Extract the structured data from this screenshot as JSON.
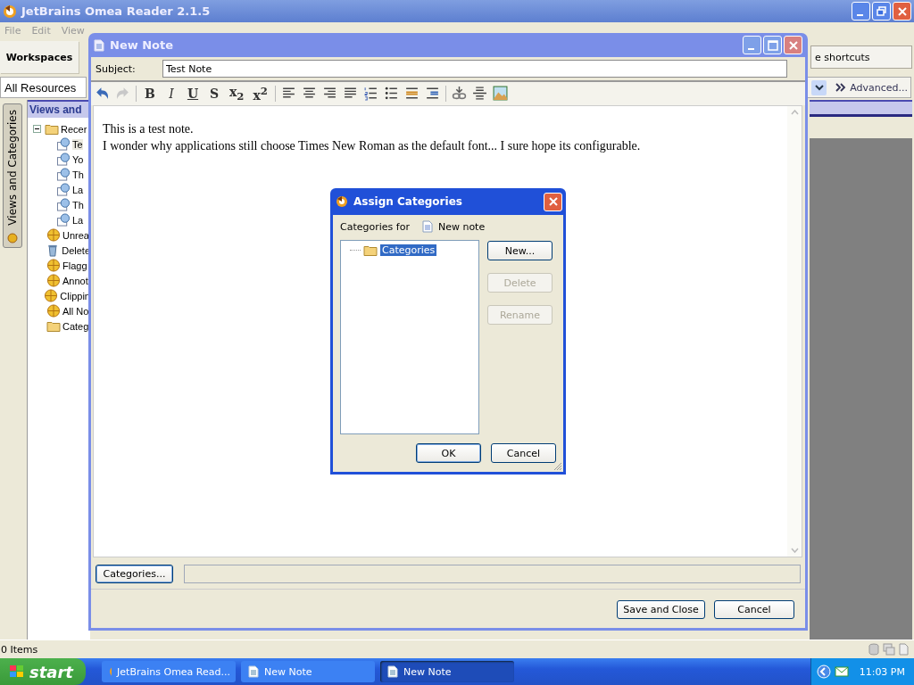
{
  "app": {
    "title": "JetBrains Omea Reader 2.1.5",
    "menu": [
      "File",
      "Edit",
      "View"
    ],
    "workspaces_tab": "Workspaces",
    "shortcuts_button": "e shortcuts",
    "resource_filter": "All Resources",
    "advanced_button": "Advanced...",
    "side_tab": "Views and Categories",
    "tree_header": "Views and",
    "tree": [
      {
        "label": "Recer",
        "kind": "folder",
        "expanded": true,
        "children": [
          {
            "label": "Te",
            "kind": "view",
            "selected": true
          },
          {
            "label": "Yo",
            "kind": "view",
            "selected": false
          },
          {
            "label": "Th",
            "kind": "view",
            "selected": false
          },
          {
            "label": "La",
            "kind": "view",
            "selected": false
          },
          {
            "label": "Th",
            "kind": "view",
            "selected": false
          },
          {
            "label": "La",
            "kind": "view",
            "selected": false
          }
        ]
      },
      {
        "label": "Unrea",
        "kind": "filter"
      },
      {
        "label": "Delete",
        "kind": "trash"
      },
      {
        "label": "Flagg",
        "kind": "filter"
      },
      {
        "label": "Annot",
        "kind": "filter"
      },
      {
        "label": "Clippin",
        "kind": "filter"
      },
      {
        "label": "All No",
        "kind": "filter"
      },
      {
        "label": "Categ",
        "kind": "folder"
      }
    ],
    "status": "0 Items"
  },
  "note_window": {
    "title": "New Note",
    "subject_label": "Subject:",
    "subject": "Test Note",
    "format_buttons": [
      {
        "label": "B"
      },
      {
        "label": "I"
      },
      {
        "label": "U"
      },
      {
        "label": "S"
      },
      {
        "label": "x$_{2}$"
      },
      {
        "label": "x$^{2}$"
      }
    ],
    "body": [
      "This is a test note.",
      "I wonder why applications still choose Times New Roman as the default font... I sure hope its configurable."
    ],
    "categories_button": "Categories...",
    "save_button": "Save and Close",
    "cancel_button": "Cancel"
  },
  "dialog": {
    "title": "Assign Categories",
    "categories_for_label": "Categories for",
    "resource": "New note",
    "tree": [
      {
        "label": "Categories",
        "selected": true
      }
    ],
    "side_buttons": [
      {
        "label": "New...",
        "disabled": false
      },
      {
        "label": "Delete",
        "disabled": true
      },
      {
        "label": "Rename",
        "disabled": true
      }
    ],
    "ok_button": "OK",
    "cancel_button": "Cancel"
  },
  "taskbar": {
    "start": "start",
    "buttons": [
      {
        "label": "JetBrains Omea Read...",
        "kind": "app",
        "selected": false
      },
      {
        "label": "New Note",
        "kind": "note",
        "selected": false
      },
      {
        "label": "New Note",
        "kind": "note",
        "selected": true
      }
    ],
    "clock": "11:03 PM"
  }
}
